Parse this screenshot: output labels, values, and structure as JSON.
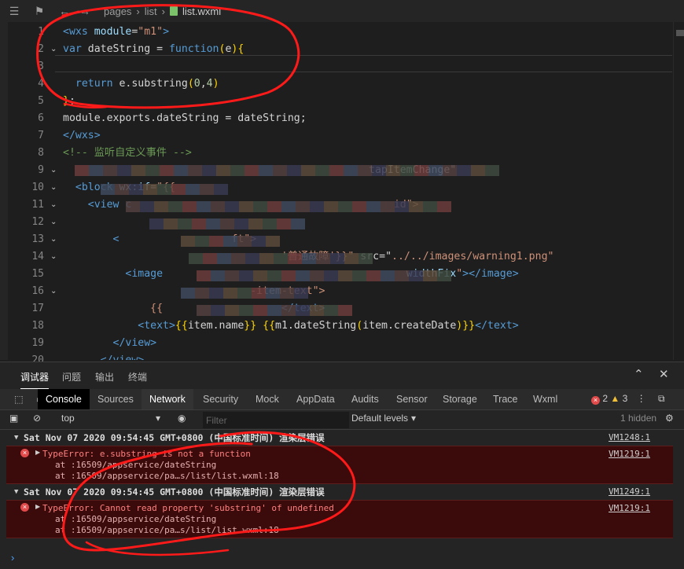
{
  "toolbar": {
    "breadcrumb": [
      "pages",
      "list",
      "list.wxml"
    ]
  },
  "editor": {
    "line_numbers": [
      "1",
      "2",
      "3",
      "4",
      "5",
      "6",
      "7",
      "8",
      "9",
      "10",
      "11",
      "12",
      "13",
      "14",
      "15",
      "16",
      "17",
      "18",
      "19",
      "20"
    ],
    "lines": [
      {
        "parts": [
          [
            "tag",
            "<wxs "
          ],
          [
            "attr",
            "module"
          ],
          [
            "plain",
            "="
          ],
          [
            "str",
            "\"m1\""
          ],
          [
            "tag",
            ">"
          ]
        ]
      },
      {
        "parts": [
          [
            "kw",
            "var "
          ],
          [
            "plain",
            "dateString = "
          ],
          [
            "kw",
            "function"
          ],
          [
            "brace",
            "("
          ],
          [
            "plain",
            "e"
          ],
          [
            "brace",
            ")"
          ],
          [
            "brace",
            "{"
          ]
        ]
      },
      {
        "parts": [
          [
            "plain",
            ""
          ]
        ]
      },
      {
        "parts": [
          [
            "plain",
            "  "
          ],
          [
            "kw",
            "return "
          ],
          [
            "plain",
            "e.substring"
          ],
          [
            "brace",
            "("
          ],
          [
            "num",
            "0"
          ],
          [
            "plain",
            ","
          ],
          [
            "num",
            "4"
          ],
          [
            "brace",
            ")"
          ]
        ]
      },
      {
        "parts": [
          [
            "brace",
            "}"
          ],
          [
            "plain",
            ";"
          ]
        ]
      },
      {
        "parts": [
          [
            "plain",
            "module.exports.dateString = dateString;"
          ]
        ]
      },
      {
        "parts": [
          [
            "tag",
            "</wxs>"
          ]
        ]
      },
      {
        "parts": [
          [
            "cmt",
            "<!-- 监听自定义事件 -->"
          ]
        ]
      },
      {
        "parts": [
          [
            "plain",
            "                                                 "
          ],
          [
            "plain",
            "tapItemChange\""
          ]
        ]
      },
      {
        "parts": [
          [
            "plain",
            "  "
          ],
          [
            "tag",
            "<b"
          ],
          [
            "tag",
            "lock "
          ],
          [
            "attr",
            "wx:if"
          ],
          [
            "plain",
            "="
          ],
          [
            "str",
            "\"{{"
          ]
        ]
      },
      {
        "parts": [
          [
            "plain",
            "    "
          ],
          [
            "tag",
            "<view c"
          ],
          [
            "plain",
            "                                          "
          ],
          [
            "str",
            "id\">"
          ]
        ]
      },
      {
        "parts": [
          [
            "plain",
            "      "
          ],
          [
            "plain",
            "  "
          ]
        ]
      },
      {
        "parts": [
          [
            "plain",
            "        "
          ],
          [
            "tag",
            "<"
          ],
          [
            "plain",
            "                  "
          ],
          [
            "str",
            "ft\">"
          ]
        ]
      },
      {
        "parts": [
          [
            "plain",
            "          "
          ],
          [
            "plain",
            "                         "
          ],
          [
            "str",
            "'普通故障'}}\""
          ],
          [
            "plain",
            " src"
          ],
          [
            "plain",
            "=\""
          ],
          [
            "str",
            "../../images/warning1.png\""
          ]
        ]
      },
      {
        "parts": [
          [
            "plain",
            "          "
          ],
          [
            "tag",
            "<image "
          ],
          [
            "plain",
            "                                      "
          ],
          [
            "attr",
            "widthFix"
          ],
          [
            "str",
            "\""
          ],
          [
            "tag",
            "></image>"
          ]
        ]
      },
      {
        "parts": [
          [
            "plain",
            "            "
          ],
          [
            "plain",
            "                  "
          ],
          [
            "str",
            "-item-text\">"
          ]
        ]
      },
      {
        "parts": [
          [
            "plain",
            "              "
          ],
          [
            "str",
            "{{"
          ],
          [
            "plain",
            "                   "
          ],
          [
            "tag",
            "</text>"
          ]
        ]
      },
      {
        "parts": [
          [
            "plain",
            "            "
          ],
          [
            "tag",
            "<text>"
          ],
          [
            "brace",
            "{{"
          ],
          [
            "plain",
            "item.name"
          ],
          [
            "brace",
            "}}"
          ],
          [
            "plain",
            " "
          ],
          [
            "brace",
            "{{"
          ],
          [
            "plain",
            "m1.dateString"
          ],
          [
            "brace",
            "("
          ],
          [
            "plain",
            "item.createDate"
          ],
          [
            "brace",
            ")"
          ],
          [
            "brace",
            "}}"
          ],
          [
            "tag",
            "</text>"
          ]
        ]
      },
      {
        "parts": [
          [
            "plain",
            "        "
          ],
          [
            "tag",
            "</view>"
          ]
        ]
      },
      {
        "parts": [
          [
            "plain",
            "      "
          ],
          [
            "tag",
            "</view>"
          ]
        ]
      }
    ]
  },
  "devtools": {
    "top_tabs": [
      "调试器",
      "问题",
      "输出",
      "终端"
    ],
    "panel_tabs": [
      "Console",
      "Sources",
      "Network",
      "Security",
      "Mock",
      "AppData",
      "Audits",
      "Sensor",
      "Storage",
      "Trace",
      "Wxml"
    ],
    "error_count": "2",
    "warning_count": "3",
    "context": "top",
    "filter_placeholder": "Filter",
    "levels": "Default levels",
    "hidden": "1 hidden",
    "groups": [
      {
        "header": "Sat Nov 07 2020 09:54:45 GMT+0800 (中国标准时间) 渲染层错误",
        "source": "VM1248:1",
        "error": "TypeError: e.substring is not a function",
        "error_source": "VM1219:1",
        "stack": [
          "at :16509/appservice/dateString",
          "at :16509/appservice/pa…s/list/list.wxml:18"
        ]
      },
      {
        "header": "Sat Nov 07 2020 09:54:45 GMT+0800 (中国标准时间) 渲染层错误",
        "source": "VM1249:1",
        "error": "TypeError: Cannot read property 'substring' of undefined",
        "error_source": "VM1219:1",
        "stack": [
          "at :16509/appservice/dateString",
          "at :16509/appservice/pa…s/list/list.wxml:18"
        ]
      }
    ],
    "prompt": "›"
  },
  "colors": {
    "annotation": "#ff1a1a",
    "error_bg": "#3b0a0a",
    "error_text": "#ff8080",
    "editor_bg": "#1e1e1e"
  }
}
